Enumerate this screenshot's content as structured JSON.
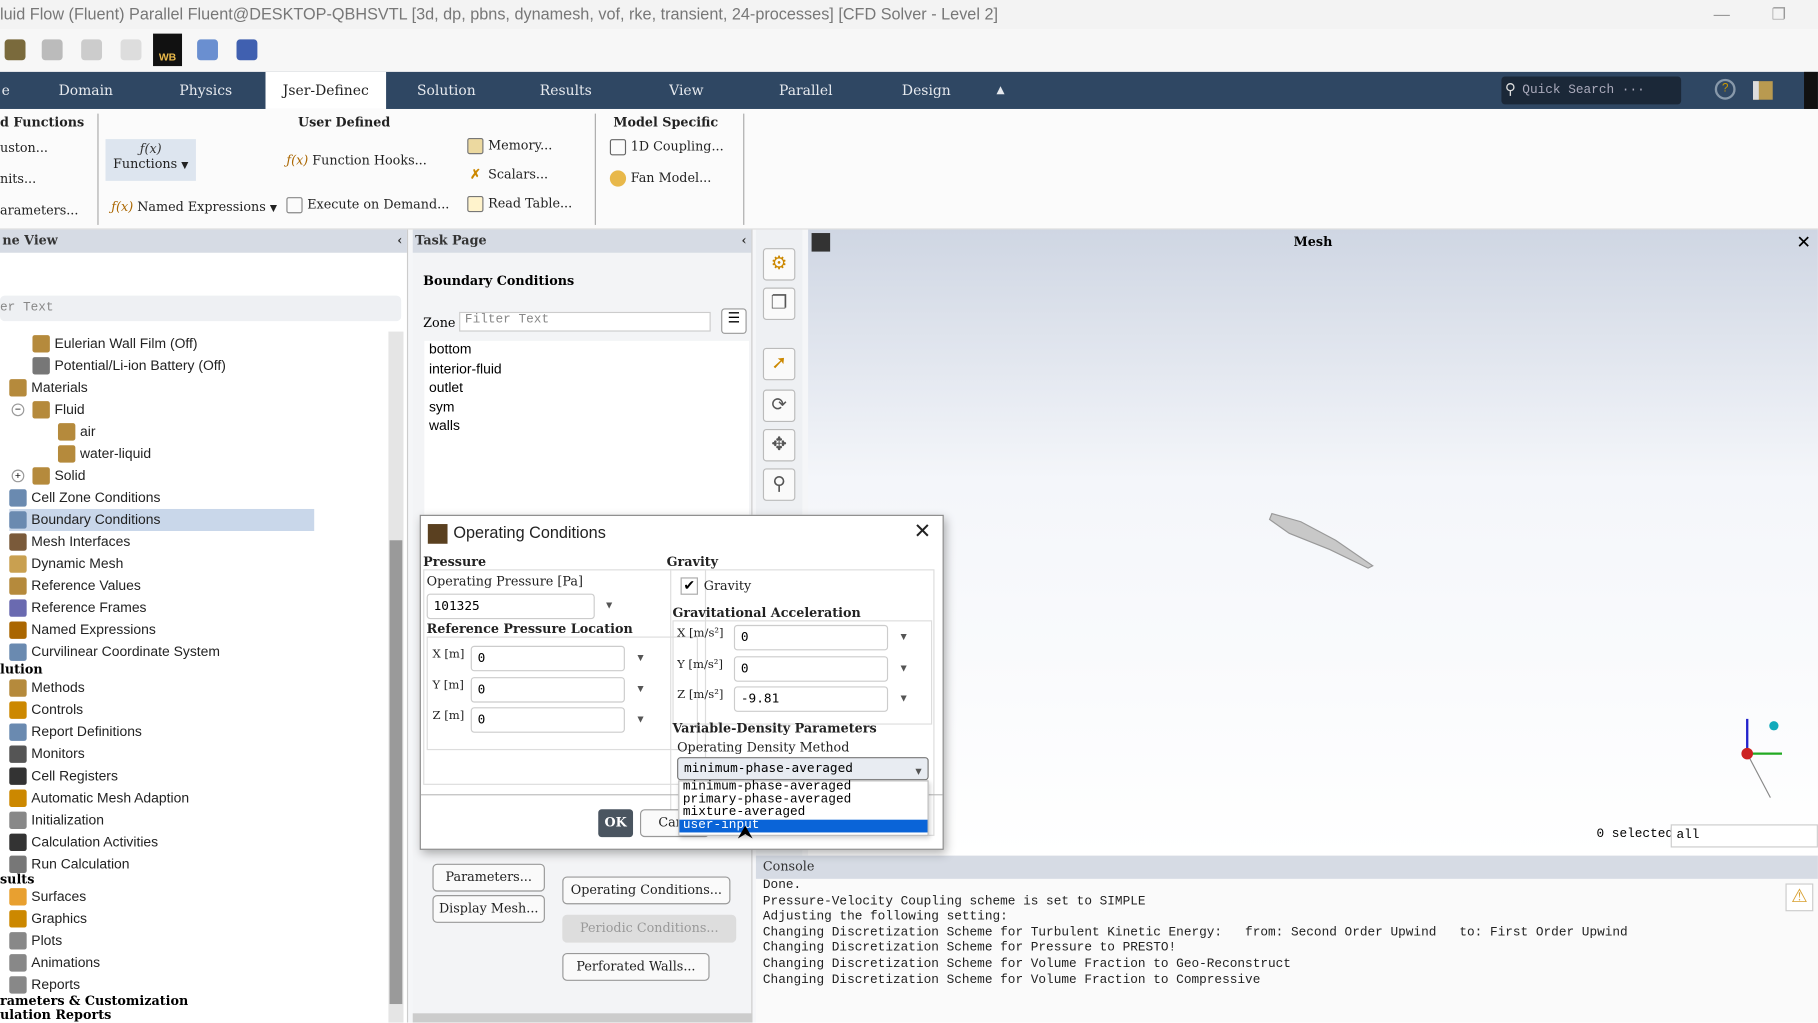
{
  "window": {
    "title": "luid Flow (Fluent) Parallel Fluent@DESKTOP-QBHSVTL  [3d, dp, pbns, dynamesh, vof, rke, transient, 24-processes] [CFD Solver - Level 2]"
  },
  "toolbar": {
    "wb_label": "WB"
  },
  "tabs": [
    "e",
    "Domain",
    "Physics",
    "Jser-Definec",
    "Solution",
    "Results",
    "View",
    "Parallel",
    "Design"
  ],
  "quick_search": {
    "placeholder": "Quick Search ···"
  },
  "ribbon": {
    "udf_header": "d Functions",
    "custom": "uston...",
    "units": "nits...",
    "parameters": "arameters...",
    "functions": "Functions",
    "named_expressions": "Named Expressions",
    "user_defined_header": "User Defined",
    "function_hooks": "Function Hooks...",
    "execute_on_demand": "Execute on Demand...",
    "memory": "Memory...",
    "scalars": "Scalars...",
    "read_table": "Read Table...",
    "model_specific_header": "Model Specific",
    "coupling": "1D Coupling...",
    "fan_model": "Fan Model..."
  },
  "tree": {
    "header": "ne View",
    "filter_placeholder": "er Text",
    "items": [
      "Eulerian Wall Film (Off)",
      "Potential/Li-ion Battery (Off)",
      "Materials",
      "Fluid",
      "air",
      "water-liquid",
      "Solid",
      "Cell Zone Conditions",
      "Boundary Conditions",
      "Mesh Interfaces",
      "Dynamic Mesh",
      "Reference Values",
      "Reference Frames",
      "Named Expressions",
      "Curvilinear Coordinate System"
    ],
    "solution_header": "lution",
    "solution_items": [
      "Methods",
      "Controls",
      "Report Definitions",
      "Monitors",
      "Cell Registers",
      "Automatic Mesh Adaption",
      "Initialization",
      "Calculation Activities",
      "Run Calculation"
    ],
    "results_header": "sults",
    "results_items": [
      "Surfaces",
      "Graphics",
      "Plots",
      "Animations",
      "Reports"
    ],
    "params_header": "rameters & Customization",
    "sim_reports_header": "ulation Reports"
  },
  "task": {
    "header": "Task Page",
    "title": "Boundary Conditions",
    "zone_label": "Zone",
    "zone_placeholder": "Filter Text",
    "zones": [
      "bottom",
      "interior-fluid",
      "outlet",
      "sym",
      "walls"
    ],
    "buttons": {
      "parameters": "Parameters...",
      "display_mesh": "Display Mesh...",
      "operating_conditions": "Operating Conditions...",
      "periodic_conditions": "Periodic Conditions...",
      "perforated_walls": "Perforated Walls..."
    }
  },
  "graphics": {
    "title": "Mesh",
    "selected": "0 selected",
    "selection_filter": "all"
  },
  "console": {
    "header": "Console",
    "lines": [
      "Done.",
      "Pressure-Velocity Coupling scheme is set to SIMPLE",
      "",
      "Adjusting the following setting:",
      "Changing Discretization Scheme for Turbulent Kinetic Energy:   from: Second Order Upwind   to: First Order Upwind",
      "Changing Discretization Scheme for Pressure to PRESTO!",
      "Changing Discretization Scheme for Volume Fraction to Geo-Reconstruct",
      "Changing Discretization Scheme for Volume Fraction to Compressive"
    ]
  },
  "dialog": {
    "title": "Operating Conditions",
    "pressure_header": "Pressure",
    "operating_pressure_label": "Operating Pressure [Pa]",
    "operating_pressure": "101325",
    "ref_location_header": "Reference Pressure Location",
    "ref": {
      "x_label": "X [m]",
      "x": "0",
      "y_label": "Y [m]",
      "y": "0",
      "z_label": "Z [m]",
      "z": "0"
    },
    "gravity_header": "Gravity",
    "gravity_checkbox": "Gravity",
    "gravity_checked": true,
    "grav_accel_header": "Gravitational Acceleration",
    "g": {
      "x_label": "X [m/s²]",
      "x": "0",
      "y_label": "Y [m/s²]",
      "y": "0",
      "z_label": "Z [m/s²]",
      "z": "-9.81"
    },
    "vd_header": "Variable-Density Parameters",
    "density_method_label": "Operating Density Method",
    "density_method": "minimum-phase-averaged",
    "options": [
      "minimum-phase-averaged",
      "primary-phase-averaged",
      "mixture-averaged",
      "user-input"
    ],
    "highlighted_option": "user-input",
    "ok": "OK",
    "cancel": "Canc"
  },
  "colors": {
    "ribbon_bg": "#2f4763",
    "highlight": "#0a64d8",
    "tree_selected": "#c9d7ea"
  }
}
